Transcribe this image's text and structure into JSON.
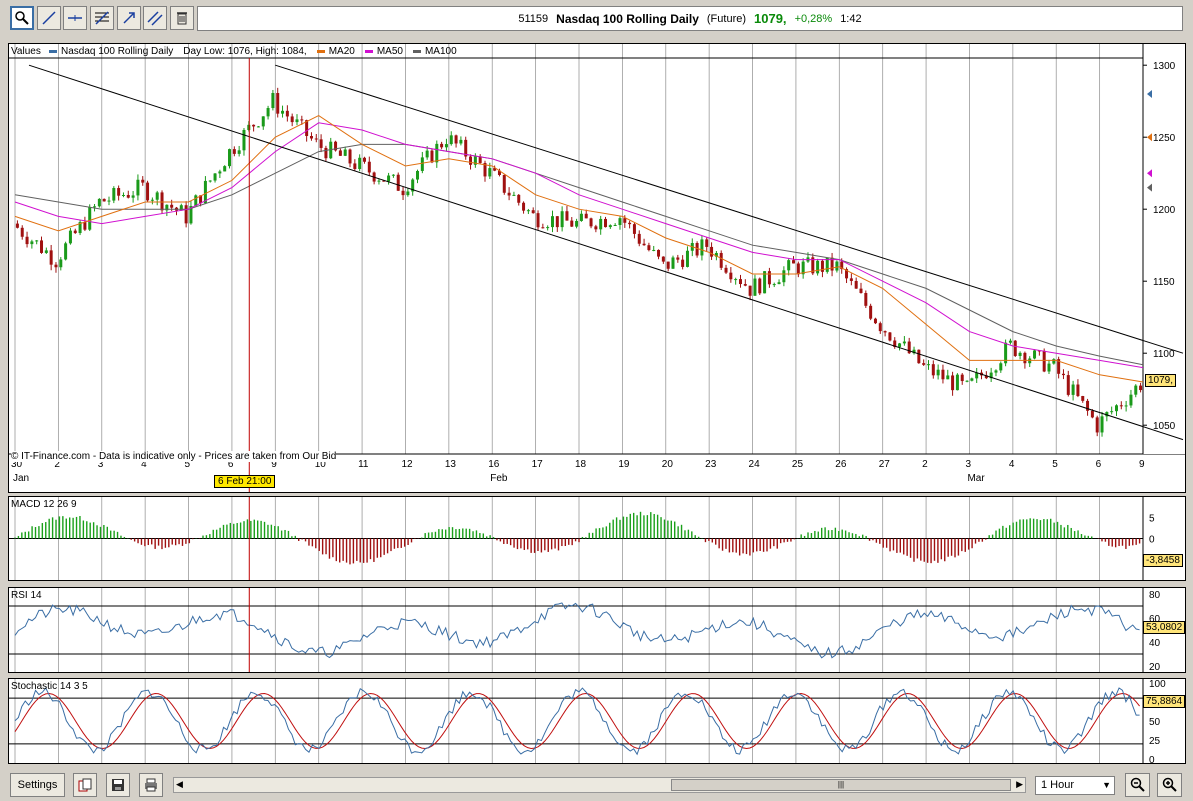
{
  "toolbar": {
    "tools": [
      "zoom-tool-icon",
      "line-tool-icon",
      "horizontal-line-tool-icon",
      "fibonacci-tool-icon",
      "arrow-tool-icon",
      "parallel-channel-tool-icon",
      "delete-tool-icon"
    ]
  },
  "header": {
    "code": "51159",
    "name": "Nasdaq 100 Rolling Daily",
    "type": "(Future)",
    "price": "1079,",
    "change": "+0,28%",
    "time": "1:42"
  },
  "main_panel": {
    "values_label": "Values",
    "legend": [
      {
        "label": "Nasdaq 100 Rolling Daily",
        "color": "#3a6ea5"
      },
      {
        "label": "Day Low: 1076, High: 1084,",
        "color": ""
      },
      {
        "label": "MA20",
        "color": "#e07010"
      },
      {
        "label": "MA50",
        "color": "#d010d0"
      },
      {
        "label": "MA100",
        "color": "#606060"
      }
    ],
    "disclaimer": "© IT-Finance.com - Data is indicative only - Prices are taken from Our Bid",
    "price_tag": "1079,",
    "cursor_label": "6 Feb 21:00"
  },
  "x_axis": {
    "ticks": [
      "30",
      "2",
      "3",
      "4",
      "5",
      "6",
      "9",
      "10",
      "11",
      "12",
      "13",
      "16",
      "17",
      "18",
      "19",
      "20",
      "23",
      "24",
      "25",
      "26",
      "27",
      "2",
      "3",
      "4",
      "5",
      "6",
      "9"
    ],
    "months": [
      "Jan",
      "Feb",
      "Mar"
    ]
  },
  "macd": {
    "label": "MACD 12 26 9",
    "value_tag": "-3,8458",
    "ticks": [
      "5",
      "0",
      "-5"
    ]
  },
  "rsi": {
    "label": "RSI 14",
    "value_tag": "53,0802",
    "ticks": [
      "80",
      "60",
      "40",
      "20"
    ]
  },
  "stoch": {
    "label": "Stochastic 14 3 5",
    "value_tag": "75,8864",
    "ticks": [
      "100",
      "75",
      "50",
      "25",
      "0"
    ]
  },
  "bottom": {
    "settings_label": "Settings",
    "interval": "1 Hour"
  },
  "chart_data": [
    {
      "type": "line",
      "series_name": "Nasdaq 100 Rolling Daily",
      "ylim": [
        1030,
        1305
      ],
      "yticks": [
        1050,
        1100,
        1150,
        1200,
        1250,
        1300
      ],
      "x": [
        "30 Jan",
        "2",
        "3",
        "4",
        "5",
        "6",
        "9",
        "10",
        "11",
        "12",
        "13",
        "16",
        "17",
        "18",
        "19",
        "20",
        "23",
        "24",
        "25",
        "26",
        "27",
        "2 Mar",
        "3",
        "4",
        "5",
        "6",
        "9"
      ],
      "close": [
        1190,
        1165,
        1205,
        1215,
        1195,
        1240,
        1275,
        1245,
        1230,
        1215,
        1250,
        1225,
        1195,
        1190,
        1195,
        1160,
        1175,
        1145,
        1160,
        1160,
        1120,
        1090,
        1075,
        1105,
        1090,
        1050,
        1079
      ],
      "ma20": [
        1195,
        1185,
        1195,
        1205,
        1205,
        1220,
        1250,
        1265,
        1245,
        1230,
        1235,
        1230,
        1210,
        1200,
        1195,
        1180,
        1170,
        1155,
        1155,
        1160,
        1145,
        1120,
        1095,
        1095,
        1095,
        1085,
        1080
      ],
      "ma50": [
        1205,
        1195,
        1190,
        1195,
        1200,
        1215,
        1240,
        1260,
        1255,
        1245,
        1240,
        1235,
        1225,
        1210,
        1200,
        1190,
        1180,
        1170,
        1165,
        1165,
        1150,
        1135,
        1115,
        1105,
        1100,
        1095,
        1090
      ],
      "ma100": [
        1210,
        1205,
        1200,
        1200,
        1200,
        1210,
        1225,
        1240,
        1245,
        1245,
        1240,
        1235,
        1225,
        1215,
        1205,
        1195,
        1185,
        1175,
        1170,
        1165,
        1155,
        1145,
        1130,
        1115,
        1105,
        1098,
        1092
      ]
    },
    {
      "type": "bar",
      "series_name": "MACD 12 26 9",
      "ylim": [
        -8,
        8
      ]
    },
    {
      "type": "line",
      "series_name": "RSI 14",
      "ylim": [
        15,
        85
      ]
    },
    {
      "type": "line",
      "series_name": "Stochastic 14 3 5",
      "ylim": [
        -5,
        105
      ]
    }
  ]
}
